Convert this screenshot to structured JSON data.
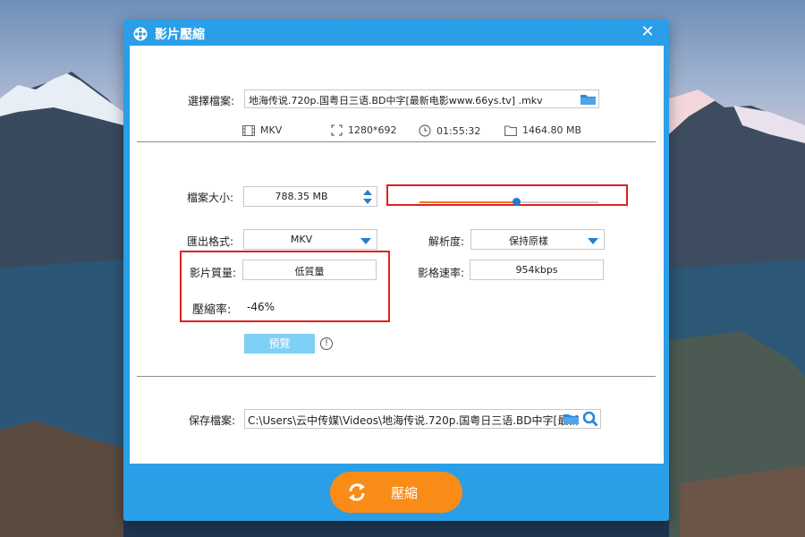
{
  "window": {
    "title": "影片壓縮"
  },
  "source": {
    "label": "選擇檔案:",
    "file": "地海传说.720p.国粤日三语.BD中字[最新电影www.66ys.tv] .mkv",
    "format": "MKV",
    "resolution": "1280*692",
    "duration": "01:55:32",
    "size": "1464.80 MB"
  },
  "settings": {
    "filesize_label": "檔案大小:",
    "filesize_value": "788.35 MB",
    "slider_fraction": 0.54,
    "format_label": "匯出格式:",
    "format_value": "MKV",
    "resolution_label": "解析度:",
    "resolution_value": "保持原樣",
    "quality_label": "影片質量:",
    "quality_value": "低質量",
    "bitrate_label": "影格速率:",
    "bitrate_value": "954kbps",
    "ratio_label": "壓縮率:",
    "ratio_value": "-46%",
    "preview_label": "預覽",
    "info_symbol": "!"
  },
  "output": {
    "label": "保存檔案:",
    "path": "C:\\Users\\云中传媒\\Videos\\地海传说.720p.国粤日三语.BD中字[最新"
  },
  "actions": {
    "compress_label": "壓縮",
    "close_symbol": "✕"
  },
  "colors": {
    "accent": "#2b9ee8",
    "button": "#f88c17",
    "slider_fill": "#f07a20",
    "slider_thumb": "#1e7ad6",
    "highlight": "#e02020"
  }
}
